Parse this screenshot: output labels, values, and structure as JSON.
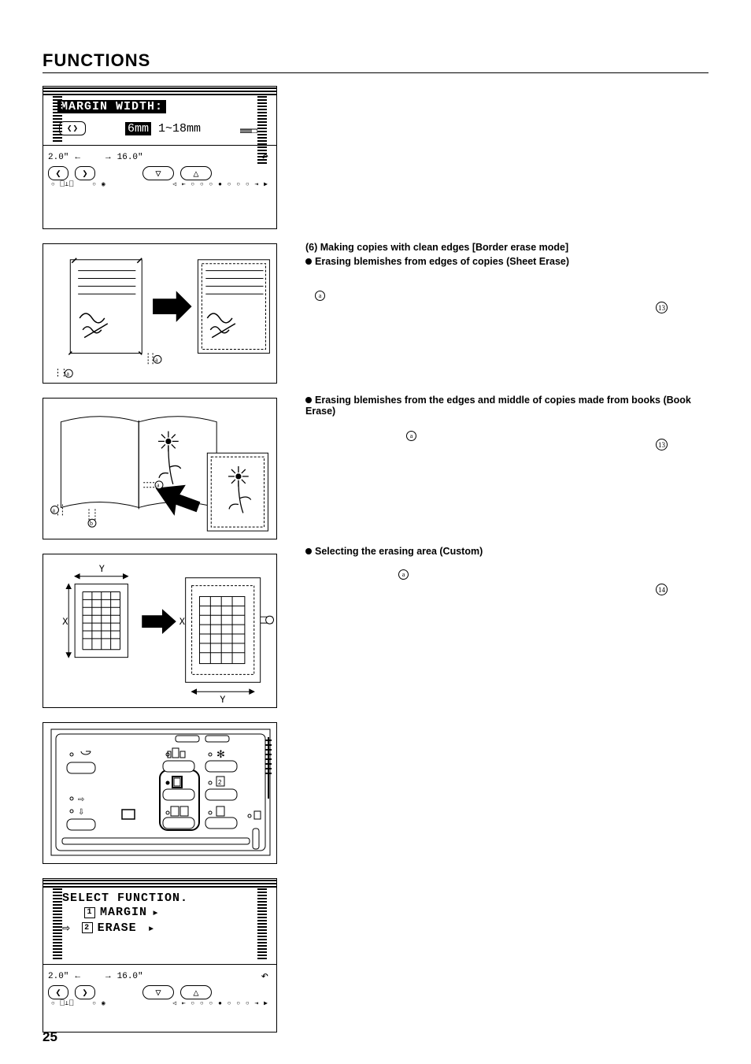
{
  "page": {
    "title": "FUNCTIONS",
    "number": "25"
  },
  "lcd_margin": {
    "title": "MARGIN WIDTH:",
    "value_hl": "6mm",
    "value_range": "1~18mm",
    "zoom_left": "2.0\"",
    "zoom_right": "16.0\""
  },
  "lcd_select": {
    "title": "SELECT FUNCTION.",
    "opt1_num": "1",
    "opt1_label": "MARGIN",
    "opt2_num": "2",
    "opt2_label": "ERASE",
    "zoom_left": "2.0\"",
    "zoom_right": "16.0\""
  },
  "fig_sheet": {
    "label_a": "a"
  },
  "fig_book": {
    "label_a": "a",
    "label_b": "b"
  },
  "fig_custom": {
    "x": "X",
    "y": "Y"
  },
  "right": {
    "h6": "(6) Making copies with clean edges [Border erase mode]",
    "sheet_title": "Erasing blemishes from edges of copies (Sheet Erase)",
    "sheet_a": "a",
    "sheet_ref": "13",
    "book_title": "Erasing blemishes from the edges and middle of copies made from books (Book Erase)",
    "book_a": "a",
    "book_ref": "13",
    "custom_title": "Selecting the erasing area (Custom)",
    "custom_a": "a",
    "custom_ref": "14"
  }
}
